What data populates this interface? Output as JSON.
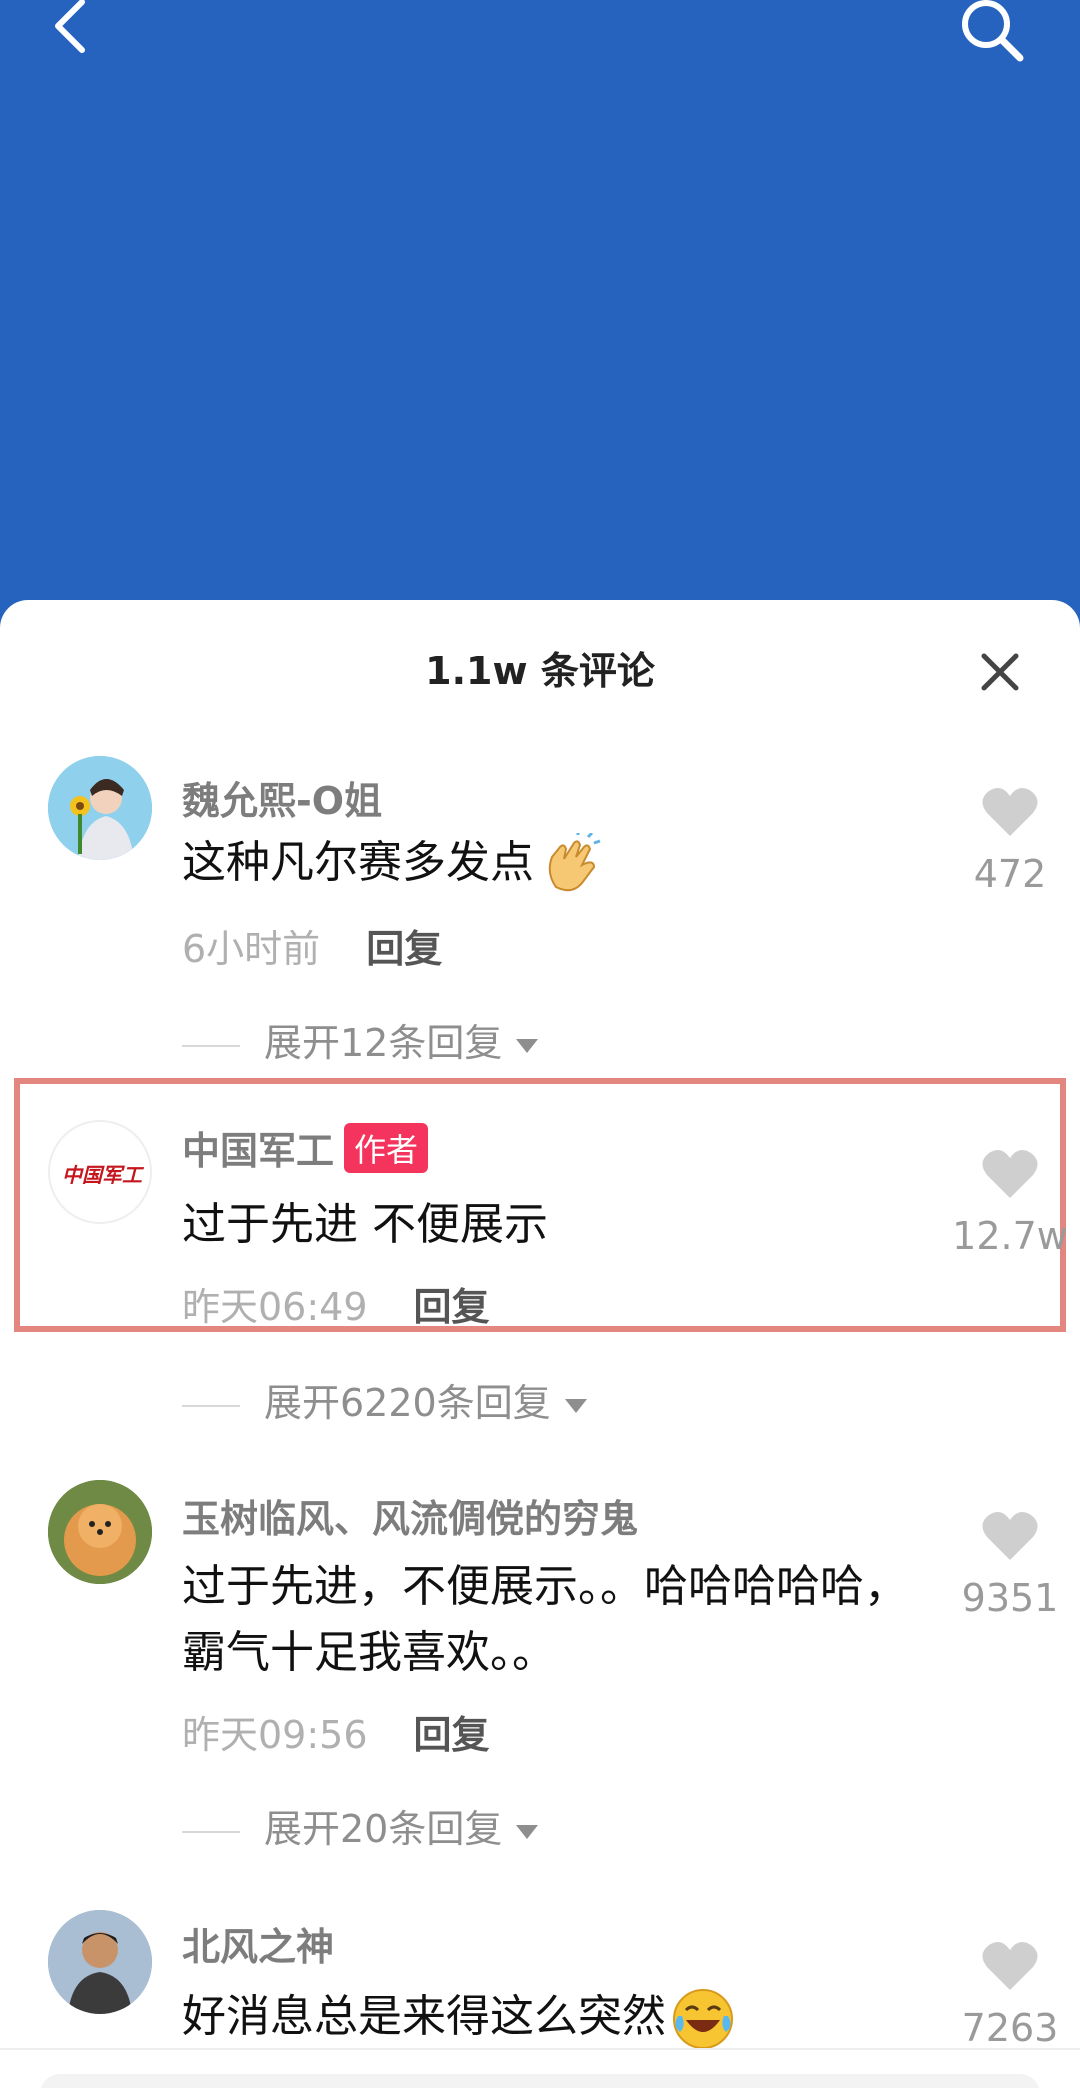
{
  "header": {
    "back_icon": "back-arrow-icon",
    "search_icon": "search-icon",
    "background_color": "#2563be"
  },
  "sheet": {
    "title": "1.1w 条评论",
    "close_icon": "close-icon"
  },
  "comments": [
    {
      "author": "魏允熙-O姐",
      "text": "这种凡尔赛多发点",
      "emoji": "clapping-hands-emoji",
      "time": "6小时前",
      "reply_label": "回复",
      "likes": "472",
      "expand_label": "展开12条回复"
    },
    {
      "author": "中国军工",
      "badge": "作者",
      "avatar_text": "中国军工",
      "text": "过于先进 不便展示",
      "time": "昨天06:49",
      "reply_label": "回复",
      "likes": "12.7w",
      "expand_label": "展开6220条回复"
    },
    {
      "author": "玉树临风、风流倜傥的穷鬼",
      "text": "过于先进，不便展示。。哈哈哈哈哈，霸气十足我喜欢。。",
      "time": "昨天09:56",
      "reply_label": "回复",
      "likes": "9351",
      "expand_label": "展开20条回复"
    },
    {
      "author": "北风之神",
      "text": "好消息总是来得这么突然",
      "emoji": "laughing-crying-emoji",
      "likes": "7263"
    }
  ],
  "colors": {
    "badge": "#f4345c",
    "highlight_border": "#e3867f"
  }
}
